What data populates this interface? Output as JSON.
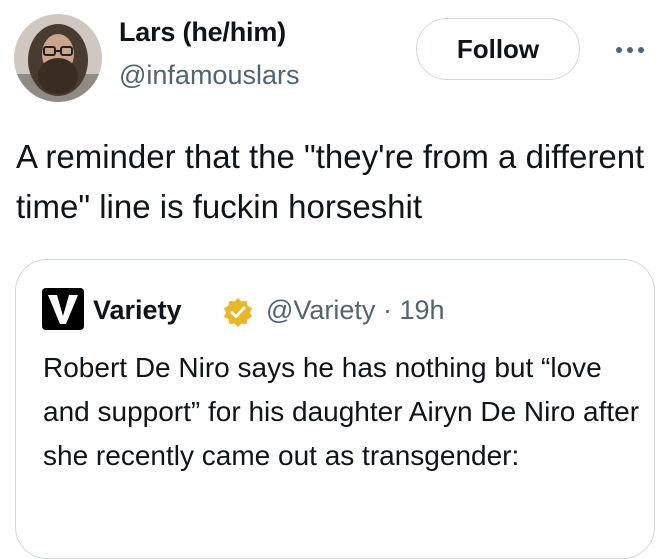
{
  "author": {
    "name": "Lars (he/him)",
    "handle": "@infamouslars"
  },
  "actions": {
    "follow_label": "Follow",
    "more_icon": "ellipsis-icon"
  },
  "tweet": {
    "text": "A reminder that the \"they're from a different time\" line is fuckin horseshit"
  },
  "quote": {
    "name": "Variety",
    "handle": "@Variety",
    "separator": "·",
    "time": "19h",
    "verified_color": "#e8b829",
    "text": "Robert De Niro says he has nothing but “love and support” for his daughter Airyn De Niro after she recently came out as transgender:"
  },
  "colors": {
    "text_primary": "#0f1419",
    "text_secondary": "#536471",
    "border": "#cfd9de"
  }
}
